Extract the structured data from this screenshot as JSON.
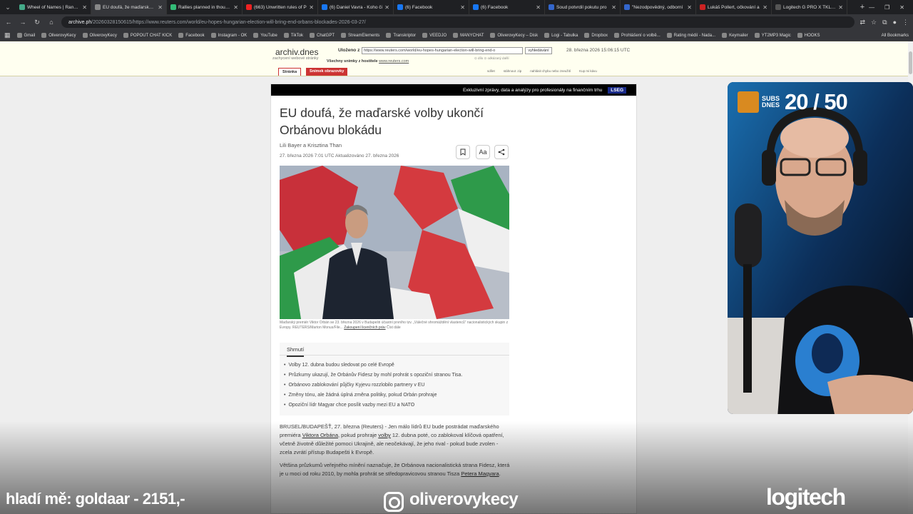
{
  "browser": {
    "tabs": [
      {
        "title": "Wheel of Names | Random",
        "color": "#4a8"
      },
      {
        "title": "EU doufá, že maďarské vo",
        "color": "#888",
        "active": true
      },
      {
        "title": "Rallies planned in thousan",
        "color": "#3b7"
      },
      {
        "title": "(663) Unwritten rules of P",
        "color": "#e22"
      },
      {
        "title": "(6) Daniel Vavra - Koho či",
        "color": "#1877f2"
      },
      {
        "title": "(6) Facebook",
        "color": "#1877f2"
      },
      {
        "title": "(6) Facebook",
        "color": "#1877f2"
      },
      {
        "title": "Soud potvrdil pokutu pro",
        "color": "#36c"
      },
      {
        "title": "\"Nezodpovědný, odborní",
        "color": "#36c"
      },
      {
        "title": "Lukáš Pollert, očkování a",
        "color": "#c22"
      },
      {
        "title": "Logitech G PRO X TKL LIG",
        "color": "#555"
      }
    ],
    "url_host": "archive.ph",
    "url_path": "/20260328150615/https://www.reuters.com/world/eu-hopes-hungarian-election-will-bring-end-orbans-blockades-2026-03-27/",
    "bookmarks": [
      "Gmail",
      "OliverovyKecy",
      "OliverovyKecy",
      "POPOUT CHAT KICK",
      "Facebook",
      "Instagram - OK",
      "YouTube",
      "TikTok",
      "ChatGPT",
      "StreamElements",
      "Transkriptor",
      "VEEDJO",
      "MANYCHAT",
      "OliverovyKecy – Disk",
      "Logi - Tabulka",
      "Dropbox",
      "Prohlášení o volbě...",
      "Rating médií - Nada...",
      "Keymailer",
      "YT2MP3 Magic",
      "HOOKS"
    ],
    "all_bookmarks": "All Bookmarks"
  },
  "archive": {
    "logo": "archiv.dnes",
    "tagline": "zachycení webové stránky",
    "saved_from_label": "Uloženo z",
    "saved_url": "https://www.reuters.com/world/eu-hopes-hungarian-election-will-bring-end-o",
    "search_button": "vyhledávání",
    "date": "28. března 2026 15:06:15 UTC",
    "all_snapshots_label": "Všechny snímky z hostitele",
    "all_snapshots_host": "www.reuters.com",
    "small_links": "⊙ dílo    ⊙ odkázaný    další",
    "links": [
      "sdílet",
      "stáhnout .zip",
      "nahlásit chybu nebo zneužití",
      "Kup mi kávu"
    ],
    "tab_page": "Stránka",
    "tab_screenshot": "Snímek obrazovky"
  },
  "article": {
    "promo": "Exkluzivní zprávy, data a analýzy pro profesionály na finančním trhu",
    "lseg": "LSEG",
    "headline": "EU doufá, že maďarské volby ukončí Orbánovu blokádu",
    "authors": "Lili Bayer a Krisztina Than",
    "dateline": "27. března 2026 7:01 UTC   Aktualizováno 27. března 2026",
    "caption": "Maďarský premiér Viktor Orbán se 23. března 2026 v Budapešti účastní prvního tzv. „Válečné shromáždění vlastenců\" nacionalistických skupin z Evropy. REUTERS/Marton Monus/File...",
    "caption_link": "Zakoupení licenčních práv",
    "caption_more": "Číst dále",
    "summary_tab": "Shrnutí",
    "summary": [
      "Volby 12. dubna budou sledovat po celé Evropě",
      "Průzkumy ukazují, že Orbánův Fidesz by mohl prohrát s opoziční stranou Tisa.",
      "Orbánovo zablokování půjčky Kyjevu rozzlobilo partnery v EU",
      "Změny tónu, ale žádná úplná změna politiky, pokud Orbán prohraje",
      "Opoziční lídr Magyar chce posílit vazby mezi EU a NATO"
    ],
    "para1": {
      "a": "BRUSEL/BUDAPEŠŤ, 27. března (Reuters) - Jen málo lídrů EU bude postrádat maďarského premiéra ",
      "link1": "Viktora Orbána",
      "b": ", pokud prohraje ",
      "link2": "volby",
      "c": " 12. dubna poté, co zablokoval klíčová opatření, včetně životně důležité pomoci Ukrajině, ale neočekávají, že jeho rival - pokud bude zvolen - zcela zvrátí přístup Budapešti k Evropě."
    },
    "para2": {
      "a": "Většina průzkumů veřejného mínění naznačuje, že Orbánova nacionalistická strana Fidesz, která je u moci od roku 2010, by mohla prohrát se středopravicovou stranou Tisza ",
      "link": "Petera Magyara",
      "b": "."
    }
  },
  "stream": {
    "subs_label": "SUBS DNES",
    "subs_count": "20 / 50",
    "donation": "hladí mě: goldaar - 2151,-",
    "instagram": "oliverovykecy",
    "sponsor": "logitech"
  }
}
